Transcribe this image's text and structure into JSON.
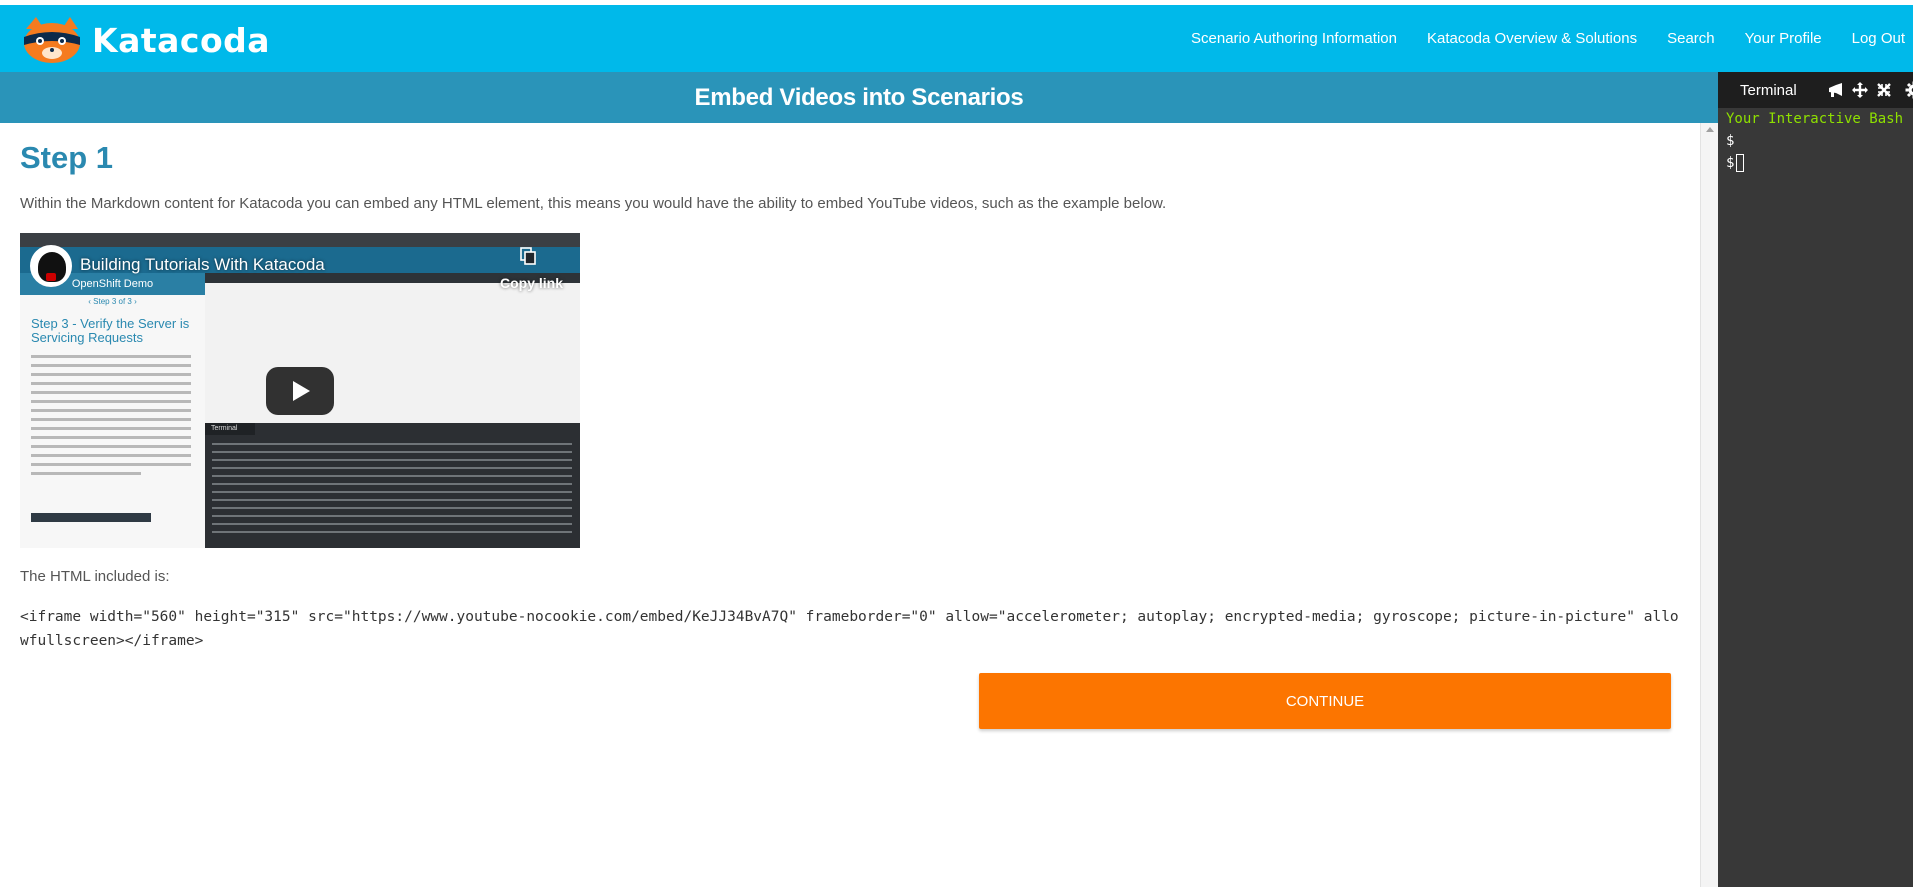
{
  "navbar": {
    "brand": "Katacoda",
    "links": [
      "Scenario Authoring Information",
      "Katacoda Overview & Solutions",
      "Search",
      "Your Profile",
      "Log Out"
    ]
  },
  "course": {
    "title": "Embed Videos into Scenarios"
  },
  "step": {
    "title": "Step 1",
    "intro": "Within the Markdown content for Katacoda you can embed any HTML element, this means you would have the ability to embed YouTube videos, such as the example below.",
    "video": {
      "title": "Building Tutorials With Katacoda",
      "copy_link": "Copy link",
      "inner_left_header": "OpenShift Demo",
      "inner_left_sub": "‹ Step 3 of 3 ›",
      "inner_left_heading": "Step 3 - Verify the Server is Servicing Requests",
      "inner_terminal_tab": "Terminal"
    },
    "html_label": "The HTML included is:",
    "code": "<iframe width=\"560\" height=\"315\" src=\"https://www.youtube-nocookie.com/embed/KeJJ34BvA7Q\" frameborder=\"0\" allow=\"accelerometer; autoplay; encrypted-media; gyroscope; picture-in-picture\" allowfullscreen></iframe>",
    "continue_label": "CONTINUE"
  },
  "terminal": {
    "tab_label": "Terminal",
    "lines": [
      "Your Interactive Bash",
      "$",
      "$"
    ],
    "icons": [
      "megaphone-icon",
      "expand-icon",
      "collapse-icon",
      "gear-icon"
    ]
  },
  "colors": {
    "navbar": "#00b9ea",
    "title_bar": "#2a94b9",
    "step_title": "#2a89b0",
    "continue": "#fc7500",
    "terminal_bg": "#383838",
    "terminal_green": "#8ee000"
  }
}
